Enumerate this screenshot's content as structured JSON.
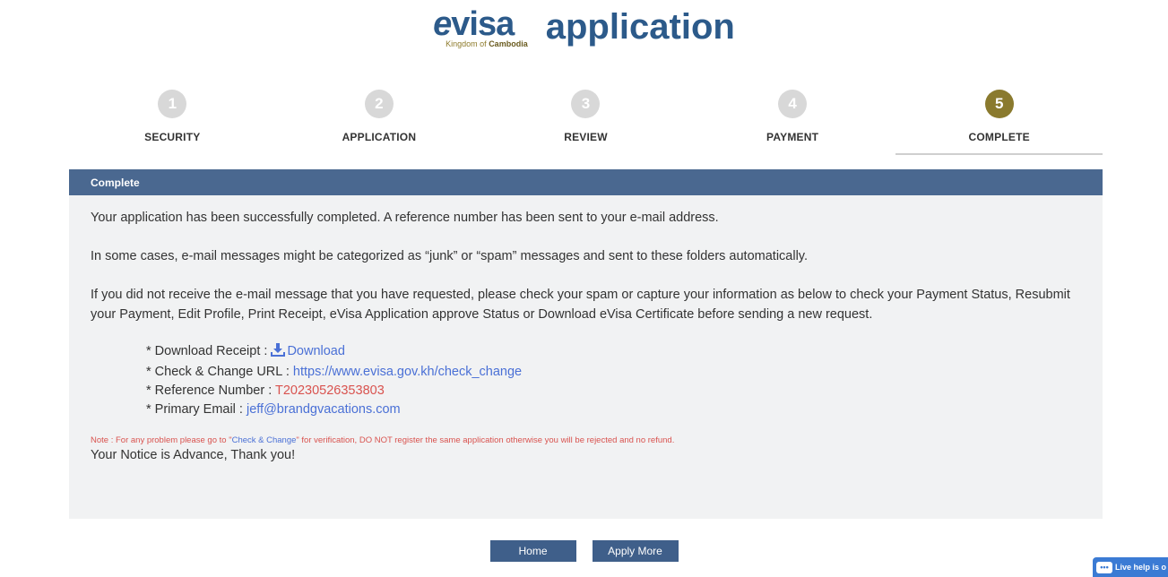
{
  "header": {
    "logo_e": "e",
    "logo_rest": "visa",
    "logo_sub_prefix": "Kingdom of ",
    "logo_sub_bold": "Cambodia",
    "title": "application"
  },
  "steps": [
    {
      "number": "1",
      "label": "SECURITY"
    },
    {
      "number": "2",
      "label": "APPLICATION"
    },
    {
      "number": "3",
      "label": "REVIEW"
    },
    {
      "number": "4",
      "label": "PAYMENT"
    },
    {
      "number": "5",
      "label": "COMPLETE"
    }
  ],
  "panel": {
    "title": "Complete",
    "para1": "Your application has been successfully completed. A reference number has been sent to your e-mail address.",
    "para2": "In some cases, e-mail messages might be categorized as “junk” or “spam” messages and sent to these folders automatically.",
    "para3": "If you did not receive the e-mail message that you have requested, please check your spam or capture your information as below to check your Payment Status, Resubmit your Payment, Edit Profile, Print Receipt, eVisa Application approve Status or Download eVisa Certificate before sending a new request.",
    "download_label": "* Download Receipt : ",
    "download_link": "Download",
    "check_label": "* Check & Change URL : ",
    "check_url": "https://www.evisa.gov.kh/check_change",
    "ref_label": "* Reference Number : ",
    "ref_value": "T20230526353803",
    "email_label": "* Primary Email : ",
    "email_value": "jeff@brandgvacations.com",
    "note_prefix": "Note : For any problem please go to \"",
    "note_link": "Check & Change",
    "note_suffix": "\" for verification, DO NOT register the same application otherwise you will be rejected and no refund.",
    "thanks": "Your Notice is Advance, Thank you!"
  },
  "buttons": {
    "home": "Home",
    "apply_more": "Apply More"
  },
  "live_help": {
    "label": "Live help is o"
  },
  "colors": {
    "brand_blue": "#2c5a8a",
    "active_step": "#8a7a2e",
    "panel_header": "#4a6890",
    "link": "#4a70d6",
    "alert": "#d9534f"
  }
}
